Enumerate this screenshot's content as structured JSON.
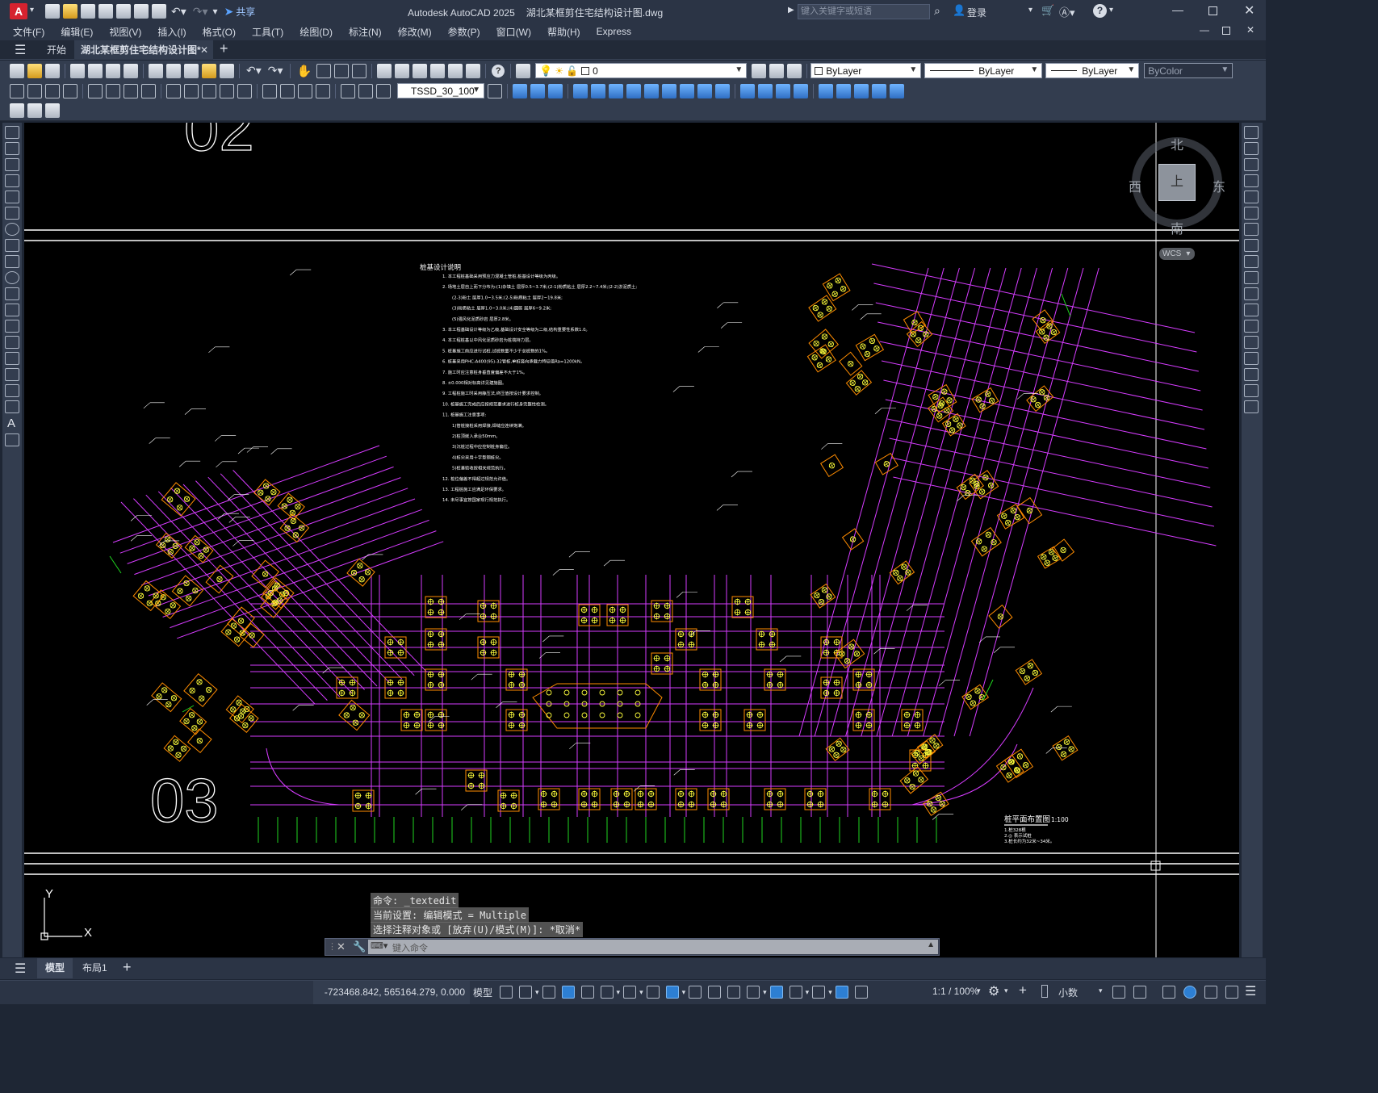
{
  "app": {
    "title": "Autodesk AutoCAD 2025",
    "file": "湖北某框剪住宅结构设计图.dwg",
    "share": "共享",
    "search_placeholder": "键入关键字或短语",
    "login": "登录"
  },
  "menu": [
    "文件(F)",
    "编辑(E)",
    "视图(V)",
    "插入(I)",
    "格式(O)",
    "工具(T)",
    "绘图(D)",
    "标注(N)",
    "修改(M)",
    "参数(P)",
    "窗口(W)",
    "帮助(H)",
    "Express"
  ],
  "tabs": {
    "start": "开始",
    "active": "湖北某框剪住宅结构设计图*",
    "add": "+"
  },
  "layer": {
    "current": "0",
    "color": "ByLayer",
    "linetype": "ByLayer",
    "lineweight": "ByLayer",
    "plotstyle": "ByColor"
  },
  "dimstyle": "TSSD_30_100",
  "viewcube": {
    "north": "北",
    "south": "南",
    "east": "东",
    "west": "西",
    "face": "上",
    "wcs": "WCS"
  },
  "drawing": {
    "grid_top": "02",
    "grid_bottom": "03",
    "notes_title": "桩基设计说明",
    "notes": [
      "1. 本工程桩基础采用预应力混凝土管桩,桩基设计等级为丙级。",
      "2. 场地土层自上而下分布为:(1)杂填土 层厚0.5~3.7米;(2-1)粉质粘土 层厚2.2~7.4米;(2-2)淤泥质土;",
      "   (2-3)粉土 层厚1.0~3.5米;(2-5)粉质粘土 层厚2~19.8米;",
      "   (3)粉质粘土 层厚1.0~3.0米;(4)圆砾 层厚6~9.2米;",
      "   (5)强风化泥质砂岩 层厚2.8米。",
      "3. 本工程基础设计等级为乙级,基础设计安全等级为二级,结构重要性系数1.0。",
      "4. 本工程桩基以中风化泥质砂岩为桩端持力层。",
      "5. 桩基施工前应进行试桩,试桩数量不少于总桩数的1%。",
      "6. 桩基采用PHC-A400(95)-32管桩,单桩竖向承载力特征值Ra=1200kN。",
      "7. 施工时应注意桩身垂直度偏差不大于1%。",
      "8. ±0.000相对标高详见建施图。",
      "9. 工程桩施工时采用静压法,终压值按设计要求控制。",
      "10. 桩基施工完成后应按规范要求进行桩身完整性检测。",
      "11. 桩基施工注意事项:",
      "   1)管桩接桩采用焊接,焊缝应连续饱满。",
      "   2)桩顶嵌入承台50mm。",
      "   3)沉桩过程中应控制桩身偏位。",
      "   4)桩尖采用十字型钢桩尖。",
      "   5)桩基验收按相关规范执行。",
      "12. 桩位偏差不得超过规范允许值。",
      "13. 工程桩施工应满足环保要求。",
      "14. 未尽事宜按国家现行规范执行。"
    ],
    "legend_title": "桩平面布置图",
    "legend_scale": "1:100",
    "legend_lines": [
      "1.桩328根",
      "2.◎ 表示试桩",
      "3.桩长约为32米~34米。"
    ]
  },
  "command": {
    "history": [
      "命令: _textedit",
      "当前设置: 编辑模式 = Multiple",
      "选择注释对象或 [放弃(U)/模式(M)]: *取消*"
    ],
    "placeholder": "键入命令"
  },
  "layouts": {
    "model": "模型",
    "layout1": "布局1"
  },
  "status": {
    "coords": "-723468.842, 565164.279, 0.000",
    "space": "模型",
    "scale": "1:1 / 100%",
    "units": "小数"
  }
}
